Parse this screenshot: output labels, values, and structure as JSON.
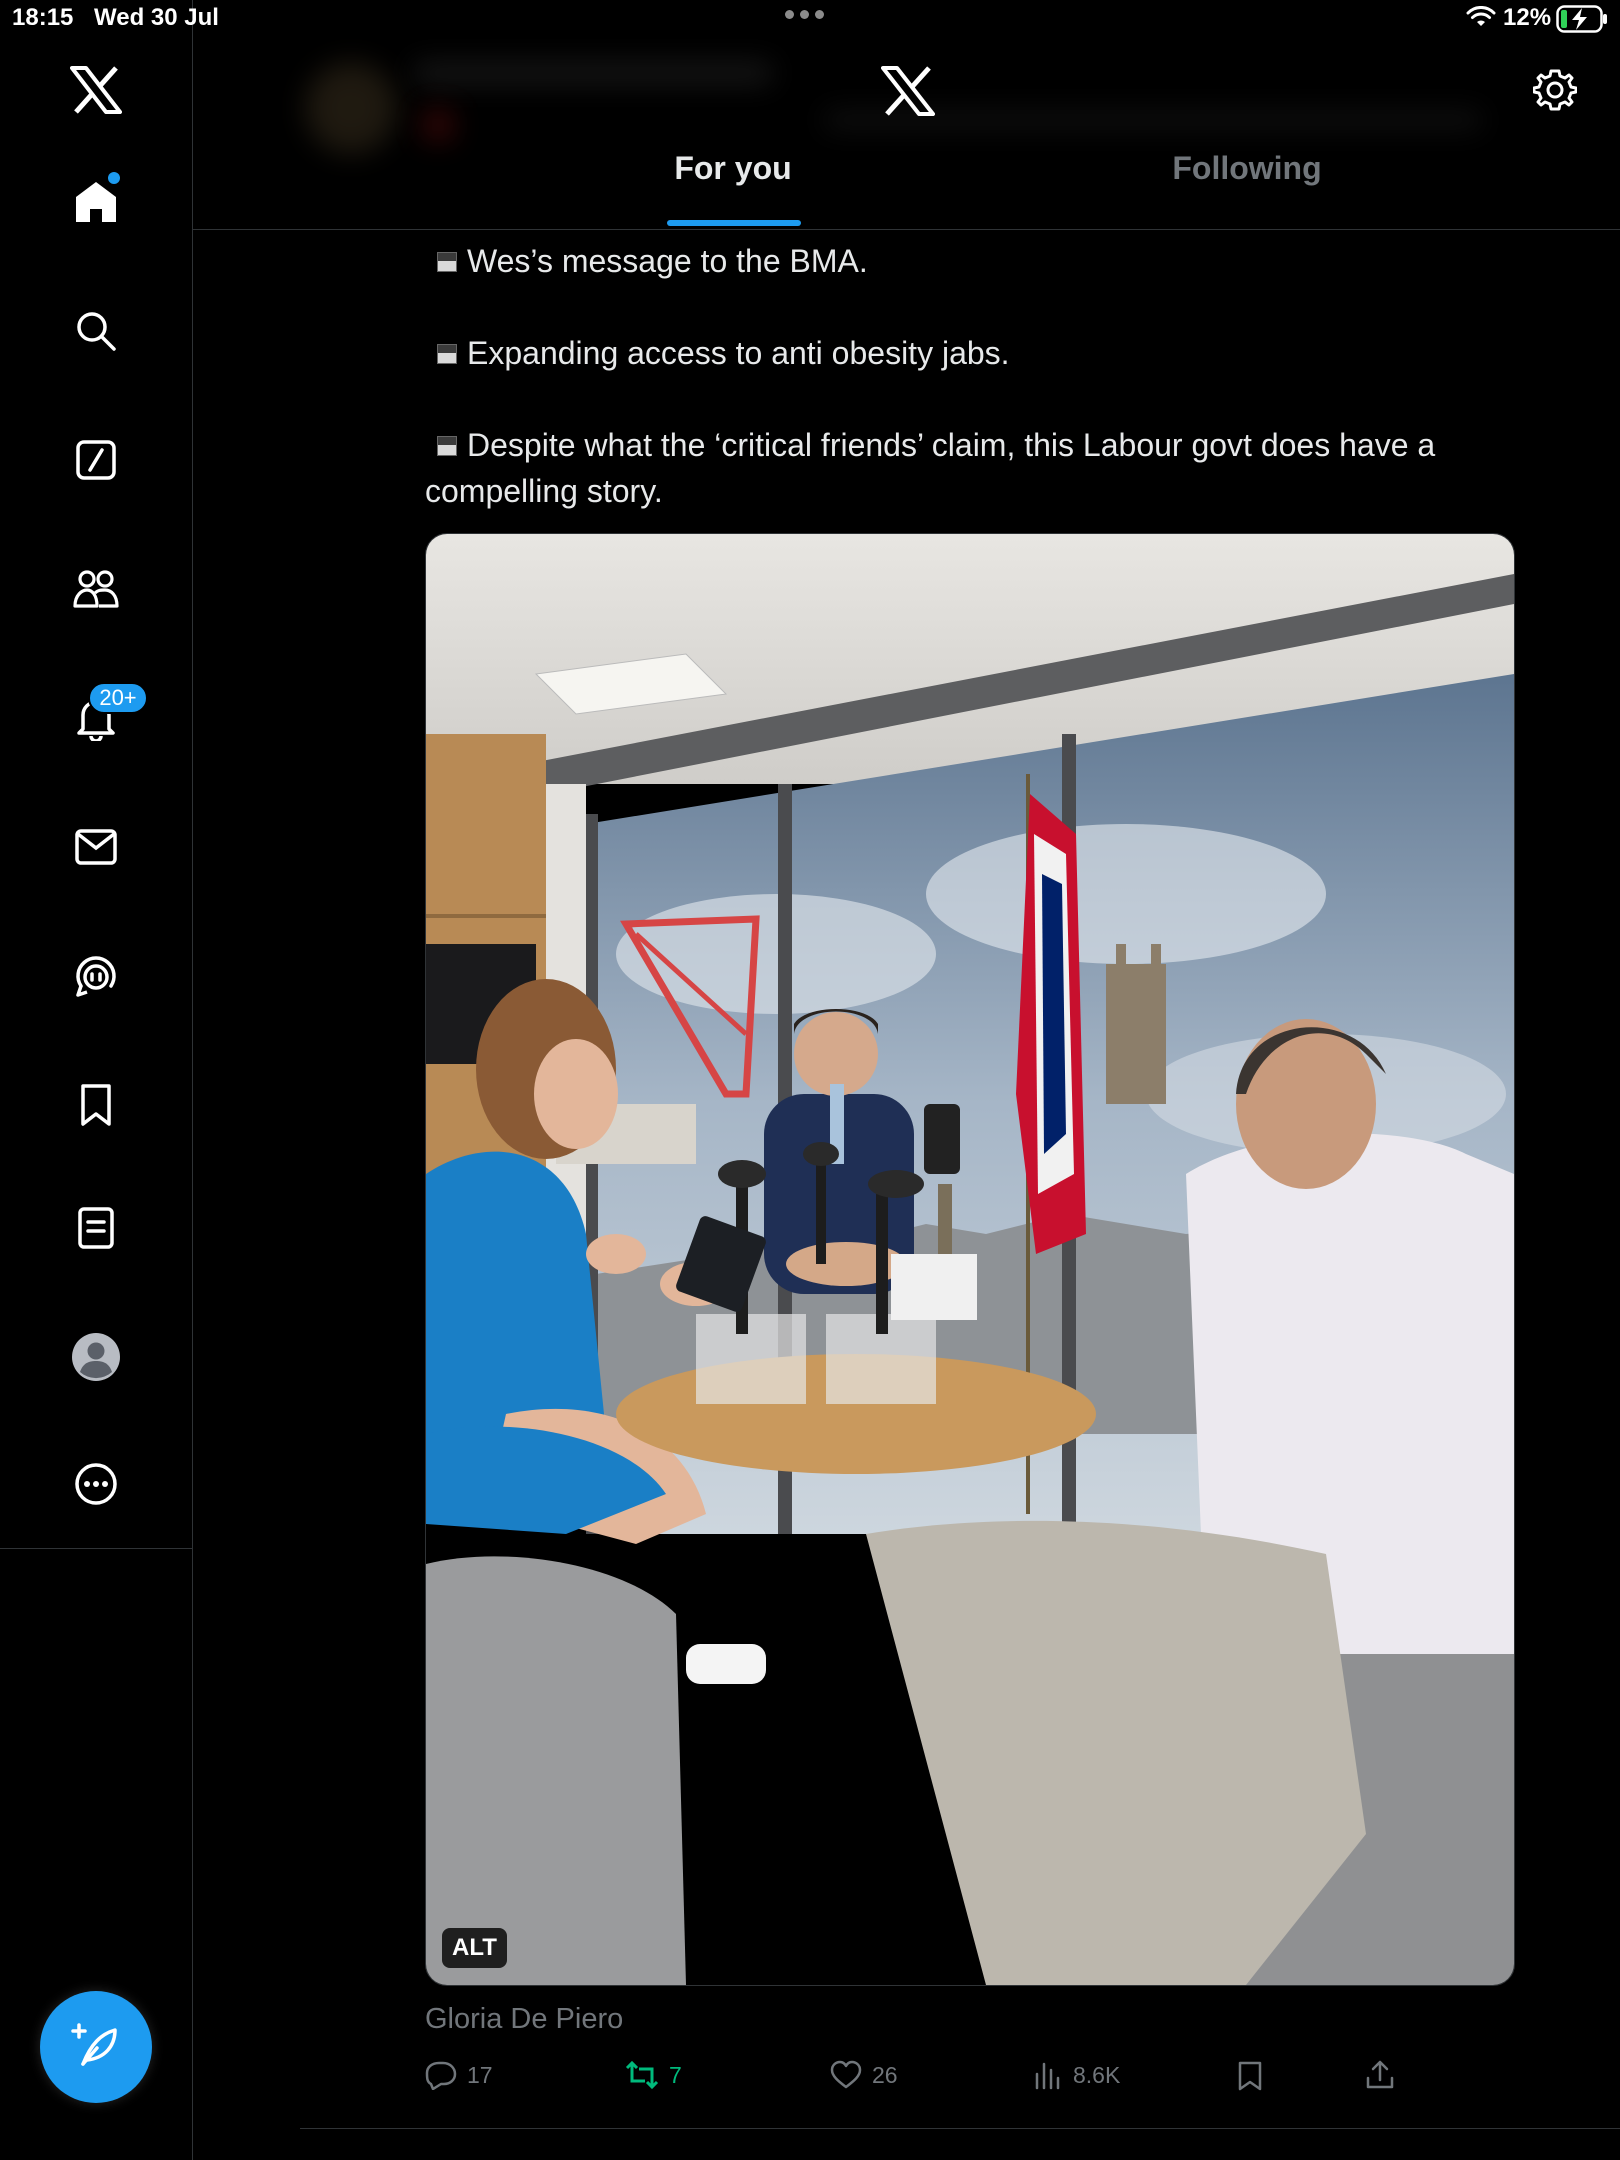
{
  "status_bar": {
    "time": "18:15",
    "date": "Wed 30 Jul",
    "battery": "12%"
  },
  "sidebar": {
    "items": [
      {
        "name": "home",
        "icon": "home-icon"
      },
      {
        "name": "explore",
        "icon": "search-icon"
      },
      {
        "name": "grok",
        "icon": "grok-icon"
      },
      {
        "name": "communities",
        "icon": "communities-icon"
      },
      {
        "name": "notifications",
        "icon": "bell-icon"
      },
      {
        "name": "messages",
        "icon": "envelope-icon"
      },
      {
        "name": "spaces",
        "icon": "spaces-icon"
      },
      {
        "name": "bookmarks",
        "icon": "bookmark-icon"
      },
      {
        "name": "lists",
        "icon": "list-icon"
      },
      {
        "name": "profile",
        "icon": "avatar-icon"
      },
      {
        "name": "more",
        "icon": "more-icon"
      }
    ],
    "notification_badge": "20+",
    "accent": "#1d9bf0"
  },
  "header": {
    "tabs": [
      {
        "label": "For you",
        "active": true
      },
      {
        "label": "Following",
        "active": false
      }
    ]
  },
  "post": {
    "lines": [
      "Wes’s message to the BMA.",
      "Expanding access to anti obesity jabs.",
      "Despite what the ‘critical friends’ claim, this Labour govt does have a compelling story."
    ],
    "image_alt_badge": "ALT",
    "author": "Gloria De Piero",
    "replies": "17",
    "reposts": "7",
    "likes": "26",
    "views": "8.6K",
    "repost_color": "#00ba7c"
  }
}
